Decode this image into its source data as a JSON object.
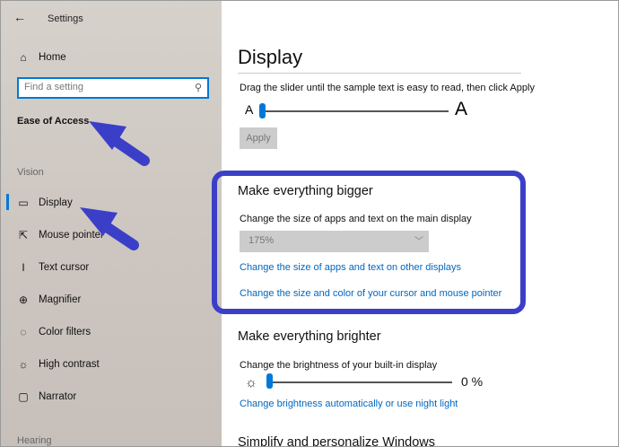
{
  "window": {
    "back_glyph": "←",
    "title": "Settings"
  },
  "sidebar": {
    "home": {
      "label": "Home",
      "icon": "home-icon"
    },
    "search": {
      "placeholder": "Find a setting",
      "icon": "search-icon"
    },
    "category": "Ease of Access",
    "group_vision": "Vision",
    "items": [
      {
        "label": "Display",
        "icon": "monitor-icon",
        "active": true
      },
      {
        "label": "Mouse pointer",
        "icon": "mouse-pointer-icon"
      },
      {
        "label": "Text cursor",
        "icon": "text-cursor-icon"
      },
      {
        "label": "Magnifier",
        "icon": "magnifier-icon"
      },
      {
        "label": "Color filters",
        "icon": "color-filters-icon"
      },
      {
        "label": "High contrast",
        "icon": "high-contrast-icon"
      },
      {
        "label": "Narrator",
        "icon": "narrator-icon"
      }
    ],
    "group_hearing": "Hearing"
  },
  "main": {
    "title": "Display",
    "text_size": {
      "description": "Drag the slider until the sample text is easy to read, then click Apply",
      "small_label": "A",
      "large_label": "A",
      "value_fraction": 0.0,
      "apply_label": "Apply"
    },
    "bigger": {
      "heading": "Make everything bigger",
      "label": "Change the size of apps and text on the main display",
      "selected": "175%",
      "link1": "Change the size of apps and text on other displays",
      "link2": "Change the size and color of your cursor and mouse pointer"
    },
    "brighter": {
      "heading": "Make everything brighter",
      "label": "Change the brightness of your built-in display",
      "value": "0 %",
      "value_fraction": 0.0,
      "link": "Change brightness automatically or use night light"
    },
    "next_heading_partial": "Simplify and personalize Windows"
  },
  "annotation": {
    "highlight_color": "#3b3fc8",
    "accent": "#0078d7",
    "link_color": "#0067c0"
  }
}
